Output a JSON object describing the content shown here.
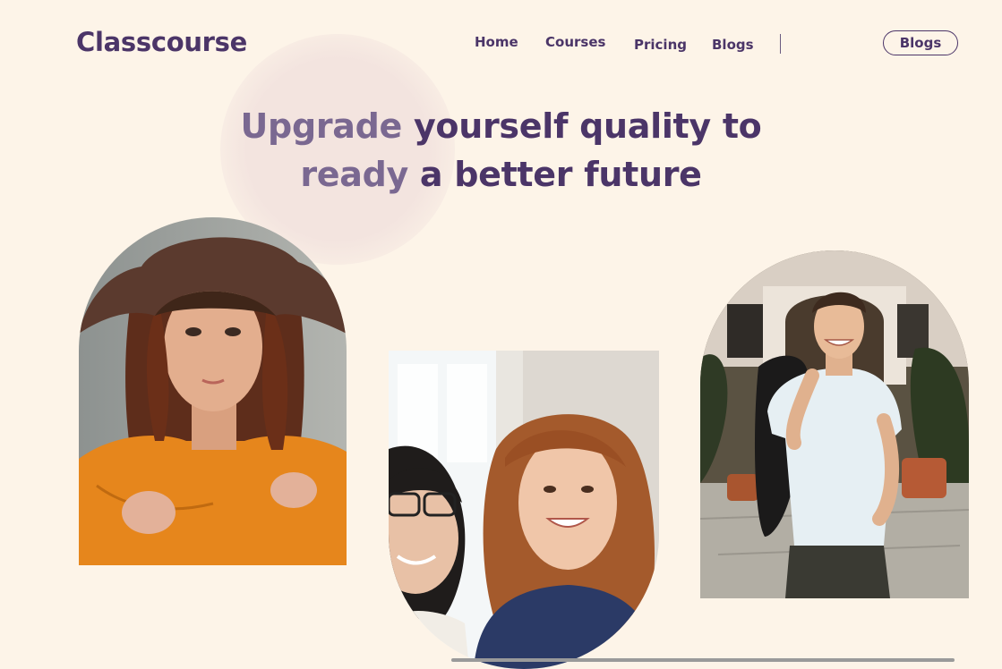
{
  "brand": "Classcourse",
  "nav": {
    "links": [
      "Home",
      "Courses",
      "Pricing",
      "Blogs"
    ],
    "button_label": "Blogs"
  },
  "hero": {
    "line1_accent": "Upgrade",
    "line1_rest": "yourself quality to",
    "line2_accent": "ready",
    "line2_rest": "a better future"
  },
  "photos": [
    {
      "name": "woman-with-hat-photo",
      "icon": "portrait-photo"
    },
    {
      "name": "two-women-smiling-photo",
      "icon": "group-photo"
    },
    {
      "name": "man-with-guitar-photo",
      "icon": "portrait-photo"
    }
  ],
  "colors": {
    "background": "#fdf4e8",
    "primary": "#4b3568",
    "accent": "#7a6891",
    "blob": "#f3e4df"
  }
}
